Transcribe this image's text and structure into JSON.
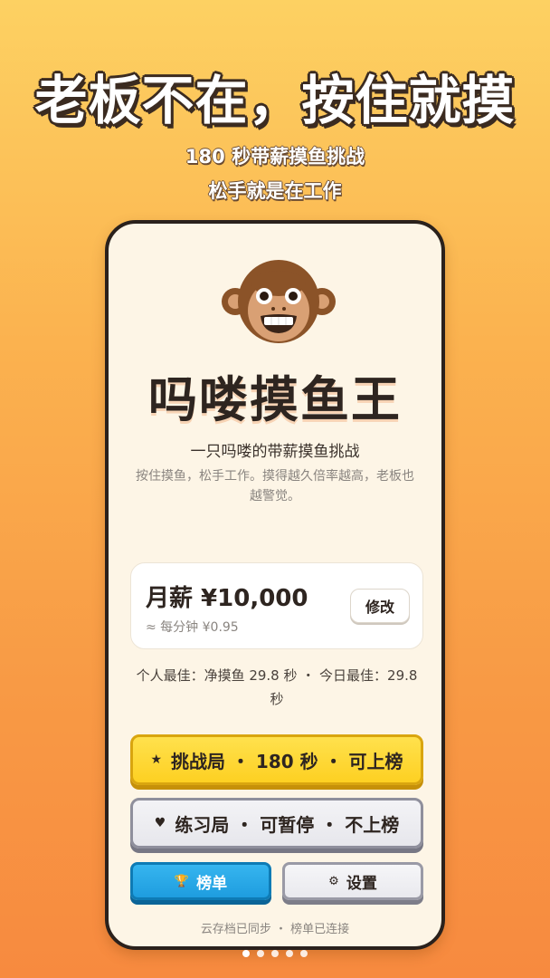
{
  "promo": {
    "headline": "老板不在，按住就摸",
    "subtitle_1": "180 秒带薪摸鱼挑战",
    "subtitle_2": "松手就是在工作"
  },
  "app": {
    "title": "吗喽摸鱼王",
    "tagline": "一只吗喽的带薪摸鱼挑战",
    "description": "按住摸鱼，松手工作。摸得越久倍率越高，老板也越警觉。"
  },
  "salary": {
    "amount": "月薪 ¥10,000",
    "per_minute": "≈ 每分钟 ¥0.95",
    "edit_label": "修改"
  },
  "best": {
    "text": "个人最佳：净摸鱼 29.8 秒 ・ 今日最佳：29.8 秒"
  },
  "buttons": {
    "challenge_label": "挑战局 ・ 180 秒 ・ 可上榜",
    "challenge_icon": "star-icon",
    "practice_label": "练习局 ・ 可暂停 ・ 不上榜",
    "practice_icon": "heart-icon",
    "rank_label": "榜单",
    "rank_icon": "trophy-icon",
    "settings_label": "设置",
    "settings_icon": "gear-icon"
  },
  "status": {
    "sync_text": "云存档已同步 ・ 榜单已连接"
  },
  "pager": {
    "count": 5,
    "active_index": 0
  },
  "colors": {
    "background_top": "#fdd162",
    "background_bottom": "#f78a3f",
    "challenge_yellow": "#fdd022",
    "rank_blue": "#1e9ddf",
    "card_cream": "#fdf5e6"
  }
}
